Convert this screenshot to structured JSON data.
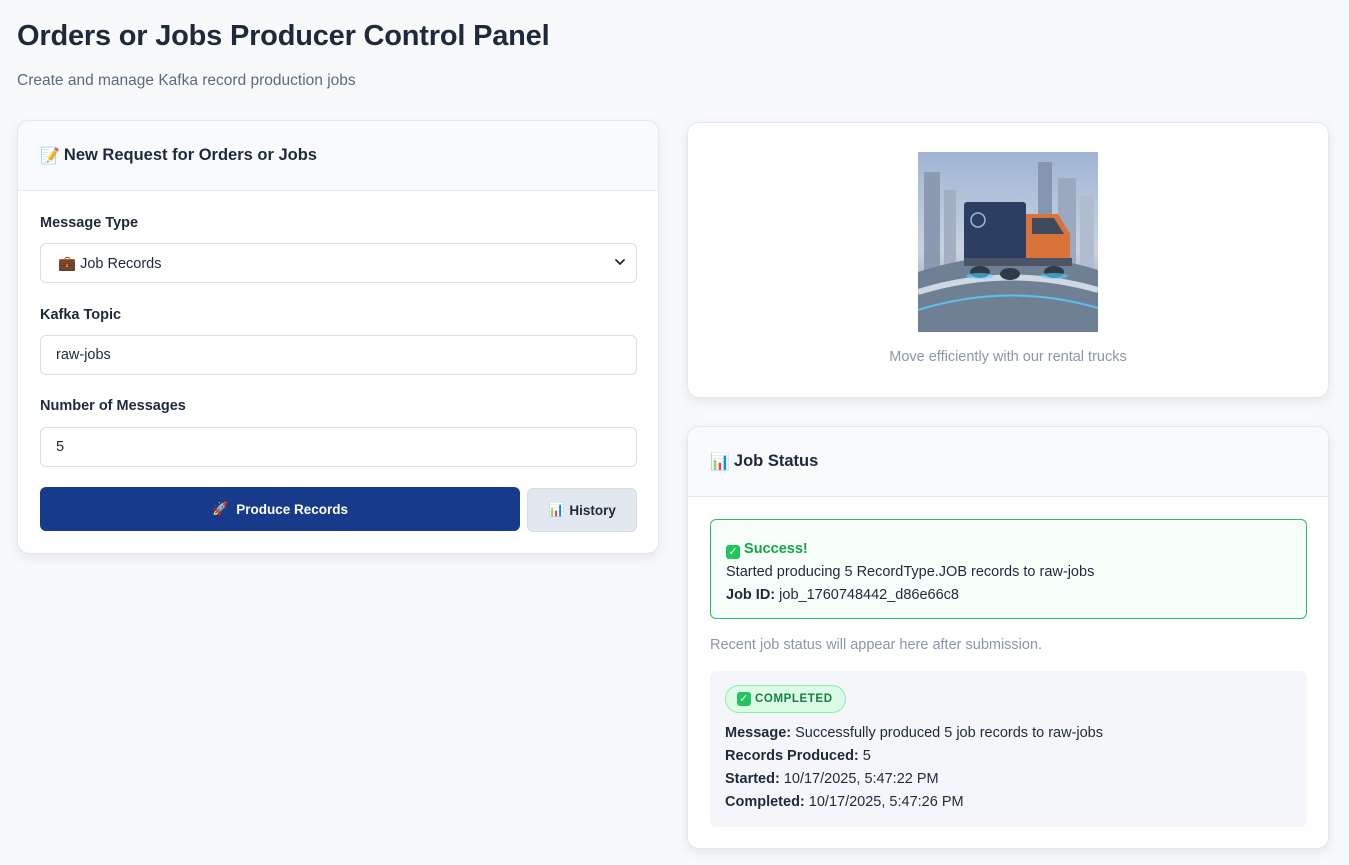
{
  "page": {
    "title": "Orders or Jobs Producer Control Panel",
    "subtitle": "Create and manage Kafka record production jobs"
  },
  "form": {
    "header_emoji": "📝",
    "header": "New Request for Orders or Jobs",
    "message_type_label": "Message Type",
    "message_type_value": "💼 Job Records",
    "topic_label": "Kafka Topic",
    "topic_value": "raw-jobs",
    "count_label": "Number of Messages",
    "count_value": "5",
    "produce_emoji": "🚀",
    "produce_label": "Produce Records",
    "history_emoji": "📊",
    "history_label": "History"
  },
  "promo": {
    "caption": "Move efficiently with our rental trucks"
  },
  "status": {
    "header_emoji": "📊",
    "header": "Job Status",
    "alert_title": "Success!",
    "alert_message": "Started producing 5 RecordType.JOB records to raw-jobs",
    "job_id_label": "Job ID:",
    "job_id_value": "job_1760748442_d86e66c8",
    "hint": "Recent job status will appear here after submission.",
    "badge": "COMPLETED",
    "message_label": "Message:",
    "message_value": "Successfully produced 5 job records to raw-jobs",
    "records_label": "Records Produced:",
    "records_value": "5",
    "started_label": "Started:",
    "started_value": "10/17/2025, 5:47:22 PM",
    "completed_label": "Completed:",
    "completed_value": "10/17/2025, 5:47:26 PM"
  },
  "colors": {
    "primary_button": "#173a8a",
    "success": "#16a34a",
    "background": "#f7f9fb"
  }
}
